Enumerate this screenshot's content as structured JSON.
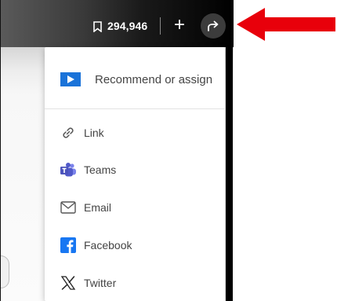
{
  "topbar": {
    "save_count": "294,946",
    "plus_label": "+",
    "icons": [
      "bookmark-icon",
      "plus-icon",
      "share-icon"
    ]
  },
  "share_menu": {
    "items": [
      {
        "label": "Recommend or assign",
        "icon": "recommend-icon",
        "color": "#1a73d9"
      },
      {
        "label": "Link",
        "icon": "link-icon"
      },
      {
        "label": "Teams",
        "icon": "teams-icon",
        "color": "#5059c9"
      },
      {
        "label": "Email",
        "icon": "email-icon"
      },
      {
        "label": "Facebook",
        "icon": "facebook-icon",
        "color": "#1877f2"
      },
      {
        "label": "Twitter",
        "icon": "x-icon"
      }
    ]
  },
  "annotation": {
    "arrow_color": "#e8000b"
  }
}
